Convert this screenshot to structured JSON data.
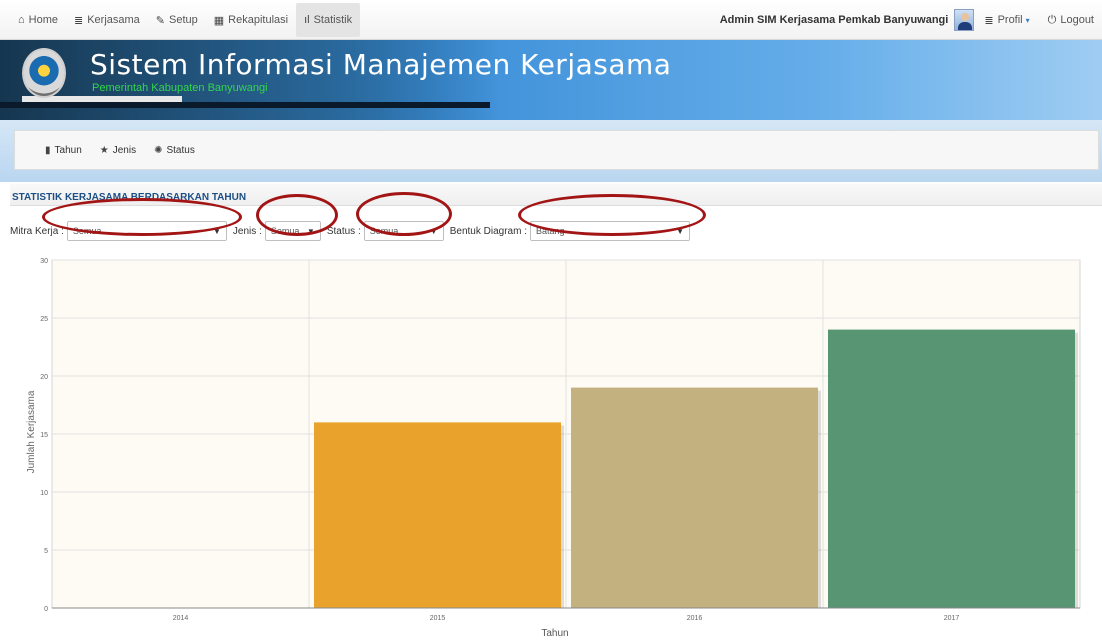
{
  "navbar": {
    "items": [
      {
        "icon": "home-icon",
        "glyph": "⌂",
        "label": "Home"
      },
      {
        "icon": "list-icon",
        "glyph": "≣",
        "label": "Kerjasama"
      },
      {
        "icon": "wrench-icon",
        "glyph": "✎",
        "label": "Setup"
      },
      {
        "icon": "table-icon",
        "glyph": "▦",
        "label": "Rekapitulasi"
      },
      {
        "icon": "bar-chart-icon",
        "glyph": "ıl",
        "label": "Statistik"
      }
    ],
    "admin_name": "Admin SIM Kerjasama Pemkab Banyuwangi",
    "profil_label": "Profil",
    "logout_label": "Logout"
  },
  "banner": {
    "title": "Sistem Informasi Manajemen Kerjasama",
    "subtitle": "Pemerintah Kabupaten Banyuwangi"
  },
  "subtabs": [
    {
      "icon": "bookmark-icon",
      "glyph": "▮",
      "label": "Tahun"
    },
    {
      "icon": "star-icon",
      "glyph": "★",
      "label": "Jenis"
    },
    {
      "icon": "gear-icon",
      "glyph": "✺",
      "label": "Status"
    }
  ],
  "panel": {
    "title": "STATISTIK KERJASAMA BERDASARKAN TAHUN"
  },
  "filters": {
    "mitra_label": "Mitra Kerja :",
    "mitra_value": "Semua",
    "jenis_label": "Jenis :",
    "jenis_value": "Semua",
    "status_label": "Status :",
    "status_value": "Semua",
    "diagram_label": "Bentuk Diagram :",
    "diagram_value": "Batang"
  },
  "colors": {
    "annotation": "#a31515",
    "plot_background": "#fdfbf3"
  },
  "chart_data": {
    "type": "bar",
    "categories": [
      "2014",
      "2015",
      "2016",
      "2017"
    ],
    "values": [
      0,
      16,
      19,
      24
    ],
    "colors": [
      "#e9a22b",
      "#e9a22b",
      "#c4b180",
      "#579573"
    ],
    "xlabel": "Tahun",
    "ylabel": "Jumlah Kerjasama",
    "ylim": [
      0,
      30
    ],
    "yticks": [
      0,
      5,
      10,
      15,
      20,
      25,
      30
    ],
    "grid": true
  }
}
